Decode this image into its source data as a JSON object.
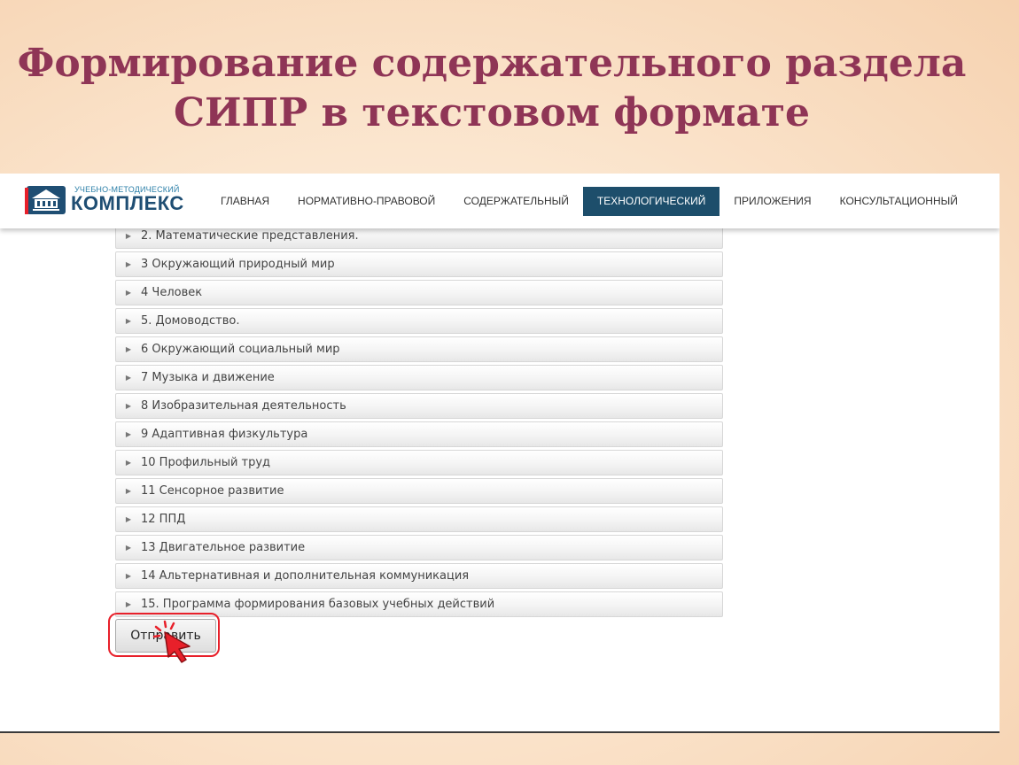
{
  "slide": {
    "title_line1": "Формирование содержательного раздела",
    "title_line2": "СИПР в текстовом формате"
  },
  "logo": {
    "small_text": "УЧЕБНО-МЕТОДИЧЕСКИЙ",
    "big_text": "КОМПЛЕКС"
  },
  "nav": {
    "items": [
      {
        "label": "ГЛАВНАЯ"
      },
      {
        "label": "НОРМАТИВНО-ПРАВОВОЙ"
      },
      {
        "label": "СОДЕРЖАТЕЛЬНЫЙ"
      },
      {
        "label": "ТЕХНОЛОГИЧЕСКИЙ"
      },
      {
        "label": "ПРИЛОЖЕНИЯ"
      },
      {
        "label": "КОНСУЛЬТАЦИОННЫЙ"
      }
    ],
    "active": "ТЕХНОЛОГИЧЕСКИЙ"
  },
  "accordion": {
    "items": [
      {
        "label": "2. Математические представления."
      },
      {
        "label": "3 Окружающий природный мир"
      },
      {
        "label": "4 Человек"
      },
      {
        "label": "5. Домоводство."
      },
      {
        "label": "6 Окружающий социальный мир"
      },
      {
        "label": "7 Музыка и движение"
      },
      {
        "label": "8 Изобразительная деятельность"
      },
      {
        "label": "9 Адаптивная физкультура"
      },
      {
        "label": "10 Профильный труд"
      },
      {
        "label": "11 Сенсорное развитие"
      },
      {
        "label": "12 ППД"
      },
      {
        "label": "13 Двигательное развитие"
      },
      {
        "label": "14 Альтернативная и дополнительная коммуникация"
      },
      {
        "label": "15. Программа формирования базовых учебных действий"
      }
    ]
  },
  "form": {
    "submit_label": "Отправить"
  },
  "icons": {
    "expand": "triangle-right-icon",
    "cursor": "hand-pointer-icon"
  },
  "colors": {
    "title": "#8f3556",
    "nav_active_bg": "#1d4e6b",
    "highlight_outline": "#e8202a"
  }
}
